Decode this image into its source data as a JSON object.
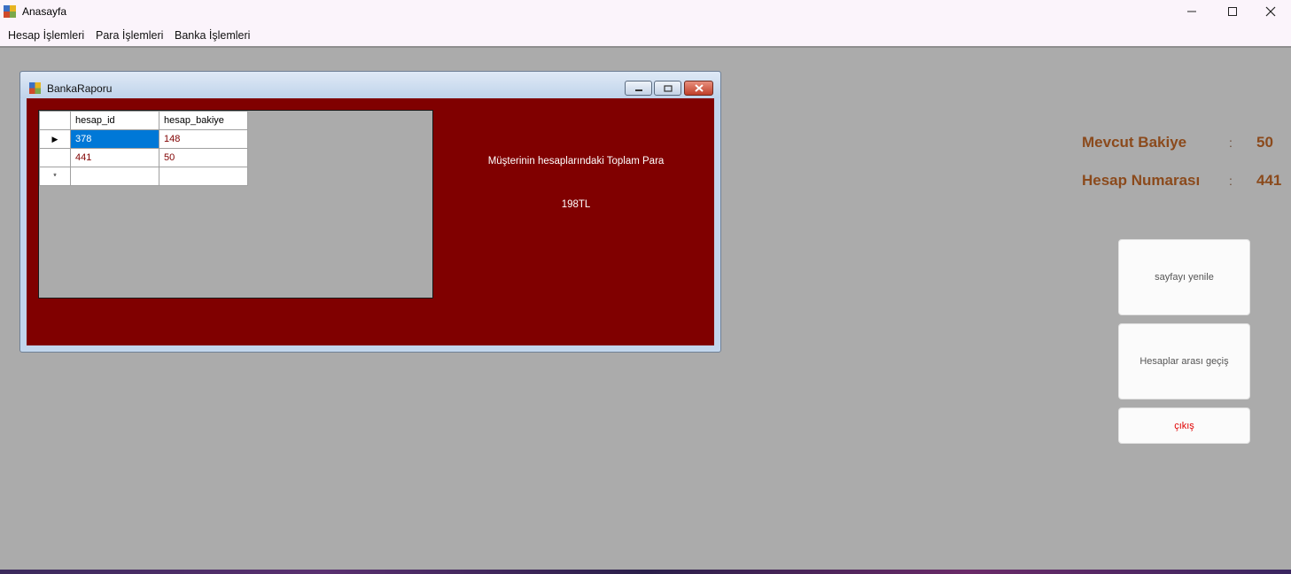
{
  "window": {
    "title": "Anasayfa"
  },
  "menu": [
    "Hesap İşlemleri",
    "Para İşlemleri",
    "Banka İşlemleri"
  ],
  "child": {
    "title": "BankaRaporu",
    "grid": {
      "columns": [
        "hesap_id",
        "hesap_bakiye"
      ],
      "rows": [
        [
          "378",
          "148"
        ],
        [
          "441",
          "50"
        ]
      ],
      "new_row_marker": "*",
      "current_row_marker": "▶"
    },
    "report_label": "Müşterinin hesaplarındaki Toplam Para",
    "report_total": "198TL"
  },
  "info": {
    "balance_label": "Mevcut Bakiye",
    "balance_value": "50",
    "account_label": "Hesap Numarası",
    "account_value": "441",
    "colon": ":"
  },
  "buttons": {
    "refresh": "sayfayı yenile",
    "transfer": "Hesaplar arası geçiş",
    "exit": "çıkış"
  },
  "colors": {
    "panel": "#800000",
    "info_text": "#8b4a1c",
    "exit_text": "#e00000",
    "selection": "#0078d7"
  }
}
